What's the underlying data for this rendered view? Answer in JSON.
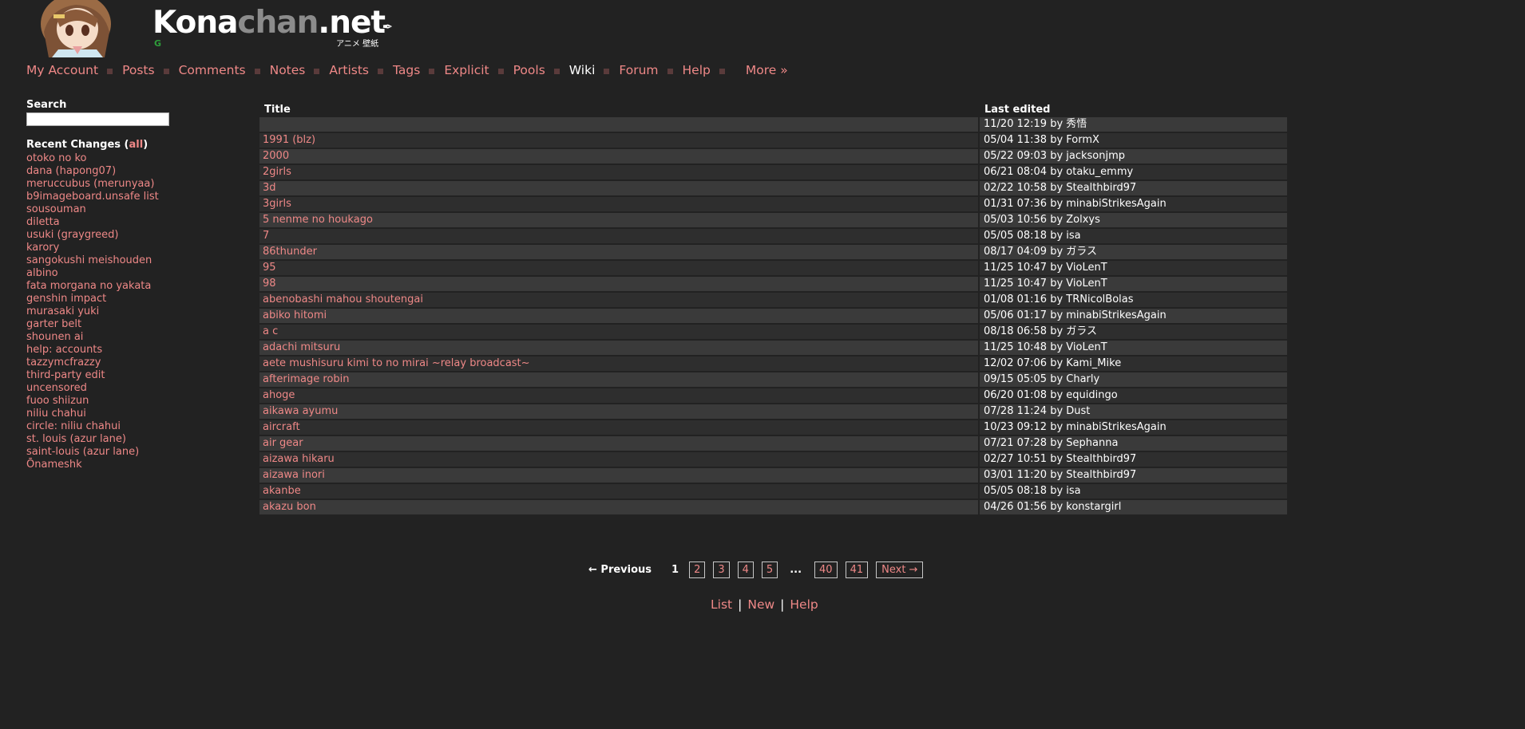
{
  "header": {
    "logo": {
      "konachan_1": "Kona",
      "konachan_2": "chan",
      "konachan_3": ".net",
      "subtitle": "アニメ 壁紙",
      "g_badge": "G"
    },
    "mascot_icon": "anime-girl-mascot"
  },
  "nav": {
    "items": [
      {
        "label": "My Account"
      },
      {
        "label": "Posts"
      },
      {
        "label": "Comments"
      },
      {
        "label": "Notes"
      },
      {
        "label": "Artists"
      },
      {
        "label": "Tags"
      },
      {
        "label": "Explicit"
      },
      {
        "label": "Pools"
      },
      {
        "label": "Wiki"
      },
      {
        "label": "Forum"
      },
      {
        "label": "Help"
      }
    ],
    "more_label": "More »"
  },
  "sidebar": {
    "search_title": "Search",
    "search_value": "",
    "recent_title_prefix": "Recent Changes (",
    "recent_all": "all",
    "recent_title_suffix": ")",
    "recent_items": [
      "otoko no ko",
      "dana (hapong07)",
      "meruccubus (merunyaa)",
      "b9imageboard.unsafe list",
      "sousouman",
      "diletta",
      "usuki (graygreed)",
      "karory",
      "sangokushi meishouden",
      "albino",
      "fata morgana no yakata",
      "genshin impact",
      "murasaki yuki",
      "garter belt",
      "shounen ai",
      "help: accounts",
      "tazzymcfrazzy",
      "third-party edit",
      "uncensored",
      "fuoo shiizun",
      "niliu chahui",
      "circle: niliu chahui",
      "st. louis (azur lane)",
      "saint-louis (azur lane)",
      "Ōnameshk"
    ]
  },
  "table": {
    "headers": {
      "title": "Title",
      "edited": "Last edited"
    },
    "rows": [
      {
        "title": "",
        "edited": "11/20 12:19 by 秀悟"
      },
      {
        "title": "1991 (blz)",
        "edited": "05/04 11:38 by FormX"
      },
      {
        "title": "2000",
        "edited": "05/22 09:03 by jacksonjmp"
      },
      {
        "title": "2girls",
        "edited": "06/21 08:04 by otaku_emmy"
      },
      {
        "title": "3d",
        "edited": "02/22 10:58 by Stealthbird97"
      },
      {
        "title": "3girls",
        "edited": "01/31 07:36 by minabiStrikesAgain"
      },
      {
        "title": "5 nenme no houkago",
        "edited": "05/03 10:56 by Zolxys"
      },
      {
        "title": "7",
        "edited": "05/05 08:18 by isa"
      },
      {
        "title": "86thunder",
        "edited": "08/17 04:09 by ガラス"
      },
      {
        "title": "95",
        "edited": "11/25 10:47 by VioLenT"
      },
      {
        "title": "98",
        "edited": "11/25 10:47 by VioLenT"
      },
      {
        "title": "abenobashi mahou shoutengai",
        "edited": "01/08 01:16 by TRNicolBolas"
      },
      {
        "title": "abiko hitomi",
        "edited": "05/06 01:17 by minabiStrikesAgain"
      },
      {
        "title": "a c",
        "edited": "08/18 06:58 by ガラス"
      },
      {
        "title": "adachi mitsuru",
        "edited": "11/25 10:48 by VioLenT"
      },
      {
        "title": "aete mushisuru kimi to no mirai ~relay broadcast~",
        "edited": "12/02 07:06 by Kami_Mike"
      },
      {
        "title": "afterimage robin",
        "edited": "09/15 05:05 by Charly"
      },
      {
        "title": "ahoge",
        "edited": "06/20 01:08 by equidingo"
      },
      {
        "title": "aikawa ayumu",
        "edited": "07/28 11:24 by Dust"
      },
      {
        "title": "aircraft",
        "edited": "10/23 09:12 by minabiStrikesAgain"
      },
      {
        "title": "air gear",
        "edited": "07/21 07:28 by Sephanna"
      },
      {
        "title": "aizawa hikaru",
        "edited": "02/27 10:51 by Stealthbird97"
      },
      {
        "title": "aizawa inori",
        "edited": "03/01 11:20 by Stealthbird97"
      },
      {
        "title": "akanbe",
        "edited": "05/05 08:18 by isa"
      },
      {
        "title": "akazu bon",
        "edited": "04/26 01:56 by konstargirl"
      }
    ]
  },
  "paginator": {
    "prev_label": "← Previous",
    "current": "1",
    "pages": [
      "2",
      "3",
      "4",
      "5"
    ],
    "ellipsis": "...",
    "last_pages": [
      "40",
      "41"
    ],
    "next_label": "Next →"
  },
  "footer": {
    "list": "List",
    "new": "New",
    "help": "Help",
    "separator": "|"
  },
  "colors": {
    "background": "#222222",
    "link": "#ee8887",
    "row_even": "#3a3a3a",
    "row_odd": "#2e2e2e"
  }
}
